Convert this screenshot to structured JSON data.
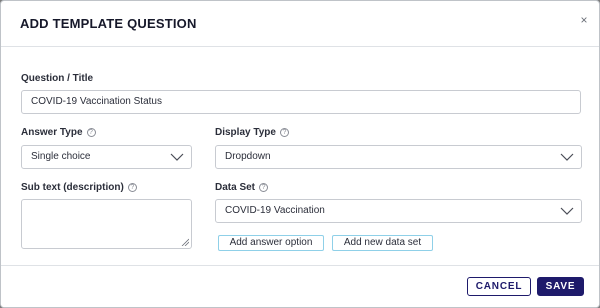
{
  "modal": {
    "title": "ADD TEMPLATE QUESTION",
    "close_glyph": "×"
  },
  "form": {
    "question": {
      "label": "Question / Title",
      "value": "COVID-19 Vaccination Status"
    },
    "answer_type": {
      "label": "Answer Type",
      "value": "Single choice",
      "help_icon": "help-circle-icon"
    },
    "display_type": {
      "label": "Display Type",
      "value": "Dropdown",
      "help_icon": "help-circle-icon"
    },
    "sub_text": {
      "label": "Sub text (description)",
      "value": "",
      "help_icon": "help-circle-icon"
    },
    "data_set": {
      "label": "Data Set",
      "value": "COVID-19 Vaccination",
      "help_icon": "help-circle-icon"
    },
    "add_answer_option_label": "Add answer option",
    "add_new_data_set_label": "Add new data set"
  },
  "footer": {
    "cancel_label": "CANCEL",
    "save_label": "SAVE"
  },
  "colors": {
    "primary": "#1e1a6b",
    "link_border": "#8fd0e8",
    "field_border": "#c8cbd1"
  }
}
